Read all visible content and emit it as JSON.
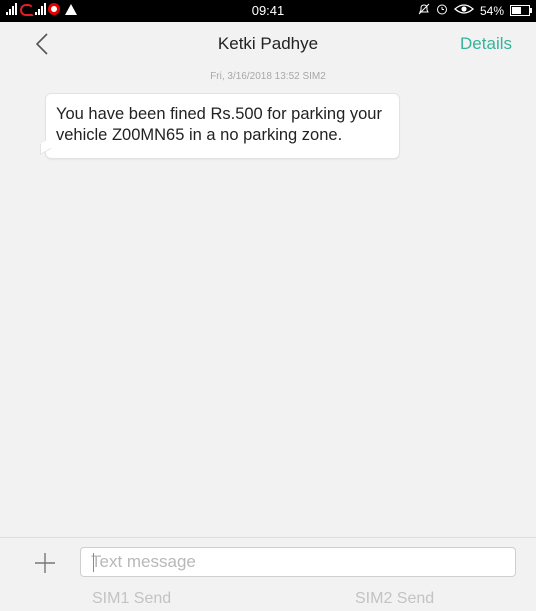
{
  "status_bar": {
    "time": "09:41",
    "battery": "54%",
    "battery_level": 0.54,
    "icons": [
      "signal-icon",
      "airtel-icon",
      "signal-icon",
      "vodafone-icon",
      "warning-icon",
      "mute-icon",
      "alarm-icon",
      "eye-icon",
      "battery-icon"
    ]
  },
  "header": {
    "back_icon": "chevron-left-icon",
    "title": "Ketki Padhye",
    "details_label": "Details",
    "accent_color": "#35b39b"
  },
  "conversation": {
    "timestamp": "Fri, 3/16/2018 13:52  SIM2",
    "messages": [
      {
        "text": "You have been fined Rs.500 for parking your vehicle Z00MN65 in a no parking zone."
      }
    ]
  },
  "composer": {
    "add_icon": "plus-icon",
    "placeholder": "Text message",
    "value": "",
    "send_sim1_label": "SIM1 Send",
    "send_sim2_label": "SIM2 Send"
  }
}
